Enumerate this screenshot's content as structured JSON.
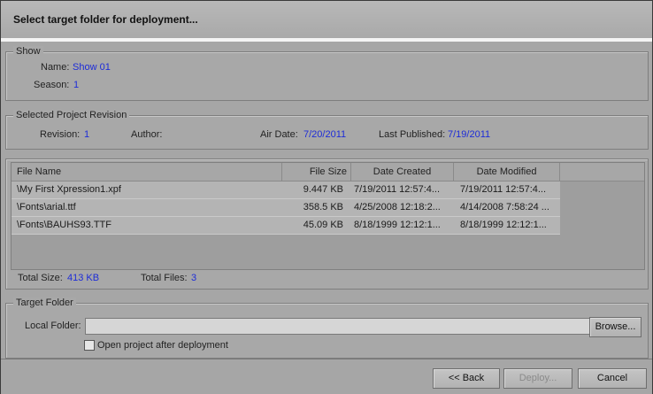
{
  "dialog": {
    "title": "Select target folder for deployment..."
  },
  "show": {
    "legend": "Show",
    "name_label": "Name:",
    "name_value": "Show 01",
    "season_label": "Season:",
    "season_value": "1"
  },
  "revision": {
    "legend": "Selected Project Revision",
    "revision_label": "Revision:",
    "revision_value": "1",
    "author_label": "Author:",
    "airdate_label": "Air Date:",
    "airdate_value": "7/20/2011",
    "published_label": "Last Published:",
    "published_value": "7/19/2011"
  },
  "files": {
    "columns": [
      "File Name",
      "File Size",
      "Date Created",
      "Date Modified"
    ],
    "rows": [
      [
        "\\My First Xpression1.xpf",
        "9.447 KB",
        "7/19/2011 12:57:4...",
        "7/19/2011 12:57:4..."
      ],
      [
        "\\Fonts\\arial.ttf",
        "358.5 KB",
        "4/25/2008 12:18:2...",
        "4/14/2008 7:58:24 ..."
      ],
      [
        "\\Fonts\\BAUHS93.TTF",
        "45.09 KB",
        "8/18/1999 12:12:1...",
        "8/18/1999 12:12:1..."
      ]
    ],
    "total_size_label": "Total Size:",
    "total_size_value": "413 KB",
    "total_files_label": "Total Files:",
    "total_files_value": "3"
  },
  "target": {
    "legend": "Target Folder",
    "local_folder_label": "Local Folder:",
    "local_folder_value": "",
    "browse_label": "Browse...",
    "open_after_label": "Open project after deployment",
    "open_after_checked": false
  },
  "buttons": {
    "back": "<< Back",
    "deploy": "Deploy...",
    "cancel": "Cancel"
  }
}
